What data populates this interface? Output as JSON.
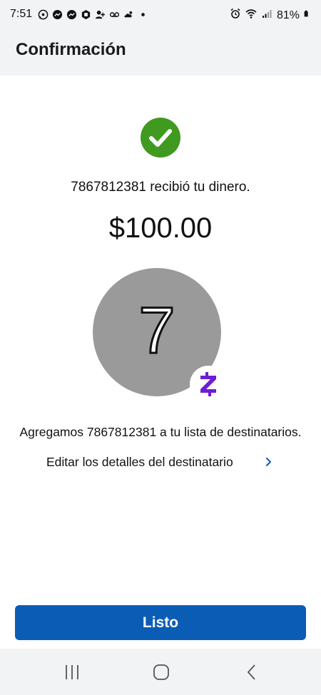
{
  "status_bar": {
    "time": "7:51",
    "battery": "81%",
    "notification_icons": [
      "whatsapp-icon",
      "messenger-icon",
      "messenger-icon",
      "app-icon",
      "person-add-icon",
      "voicemail-icon",
      "weather-icon",
      "dot-icon"
    ],
    "right_icons": [
      "alarm-icon",
      "wifi-icon",
      "signal-icon",
      "battery-icon"
    ]
  },
  "header": {
    "title": "Confirmación"
  },
  "confirmation": {
    "received_text": "7867812381 recibió tu dinero.",
    "amount": "$100.00",
    "avatar_initial": "7",
    "added_text": "Agregamos 7867812381 a tu lista de destinatarios.",
    "edit_link": "Editar los detalles del destinatario"
  },
  "footer": {
    "done_label": "Listo"
  },
  "colors": {
    "success": "#3f9a1f",
    "primary_button": "#0b5cb5",
    "zelle_purple": "#6d1ed4",
    "avatar_gray": "#9a9a9a",
    "link_chevron": "#0b5cb5"
  },
  "nav_bar": {
    "buttons": [
      "recents-icon",
      "home-icon",
      "back-icon"
    ]
  }
}
